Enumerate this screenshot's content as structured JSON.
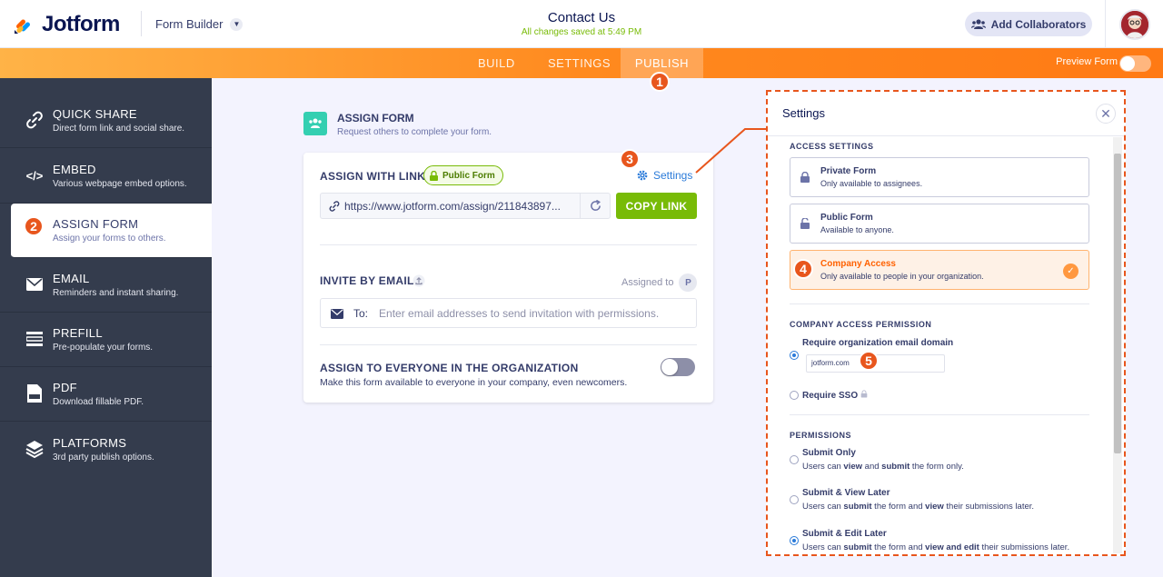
{
  "header": {
    "brand": "Jotform",
    "form_builder": "Form Builder",
    "form_title": "Contact Us",
    "saved_status": "All changes saved at 5:49 PM",
    "collaborators_label": "Add Collaborators"
  },
  "nav": {
    "tabs": [
      "BUILD",
      "SETTINGS",
      "PUBLISH"
    ],
    "active_tab": "PUBLISH",
    "preview_label": "Preview Form"
  },
  "badges": [
    "1",
    "2",
    "3",
    "4",
    "5"
  ],
  "sidebar": {
    "items": [
      {
        "label": "QUICK SHARE",
        "sub": "Direct form link and social share.",
        "icon": "link-icon"
      },
      {
        "label": "EMBED",
        "sub": "Various webpage embed options.",
        "icon": "code-icon"
      },
      {
        "label": "ASSIGN FORM",
        "sub": "Assign your forms to others.",
        "icon": "assign-icon"
      },
      {
        "label": "EMAIL",
        "sub": "Reminders and instant sharing.",
        "icon": "envelope-icon"
      },
      {
        "label": "PREFILL",
        "sub": "Pre-populate your forms.",
        "icon": "prefill-icon"
      },
      {
        "label": "PDF",
        "sub": "Download fillable PDF.",
        "icon": "pdf-icon"
      },
      {
        "label": "PLATFORMS",
        "sub": "3rd party publish options.",
        "icon": "layers-icon"
      }
    ],
    "active": "ASSIGN FORM"
  },
  "assign": {
    "title": "ASSIGN FORM",
    "subtitle": "Request others to complete your form.",
    "with_link_label": "ASSIGN WITH LINK",
    "public_badge": "Public Form",
    "settings_link": "Settings",
    "url": "https://www.jotform.com/assign/211843897...",
    "copy_label": "COPY LINK",
    "invite_label": "INVITE BY EMAIL",
    "assigned_to": "Assigned to",
    "assigned_initial": "P",
    "to_label": "To:",
    "email_placeholder": "Enter email addresses to send invitation with permissions.",
    "everyone_label": "ASSIGN TO EVERYONE IN THE ORGANIZATION",
    "everyone_sub": "Make this form available to everyone in your company, even newcomers."
  },
  "panel": {
    "title": "Settings",
    "access_settings_label": "ACCESS SETTINGS",
    "options": [
      {
        "name": "Private Form",
        "desc": "Only available to assignees."
      },
      {
        "name": "Public Form",
        "desc": "Available to anyone."
      },
      {
        "name": "Company Access",
        "desc": "Only available to people in your organization.",
        "selected": true
      }
    ],
    "company_permission_label": "COMPANY ACCESS PERMISSION",
    "require_domain": "Require organization email domain",
    "domain_value": "jotform.com",
    "require_sso": "Require SSO",
    "permissions_label": "PERMISSIONS",
    "permissions": [
      {
        "name": "Submit Only",
        "desc_parts": [
          "Users can ",
          "view",
          " and ",
          "submit",
          " the form only."
        ]
      },
      {
        "name": "Submit & View Later",
        "desc_parts": [
          "Users can ",
          "submit",
          " the form and ",
          "view",
          " their submissions later."
        ]
      },
      {
        "name": "Submit & Edit Later",
        "desc_parts": [
          "Users can ",
          "submit",
          " the form and ",
          "view and edit",
          " their submissions later."
        ],
        "selected": true
      }
    ]
  },
  "colors": {
    "orange": "#ff7a14",
    "green": "#78bb07",
    "badge": "#e8561d",
    "sidebar": "#343c4d",
    "link_blue": "#2b7bd9"
  }
}
